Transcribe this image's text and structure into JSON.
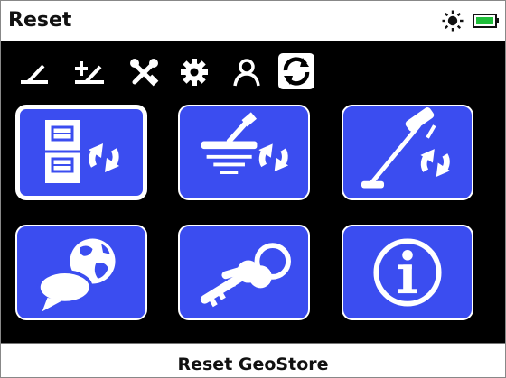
{
  "header": {
    "title": "Reset",
    "icons": [
      "sun-icon",
      "battery-icon"
    ],
    "battery_color": "#1fbe3a"
  },
  "tabs": [
    {
      "name": "detect-tab",
      "icon": "detect-icon",
      "selected": false
    },
    {
      "name": "ground-tab",
      "icon": "ground-balance-icon",
      "selected": false
    },
    {
      "name": "tools-tab",
      "icon": "tools-icon",
      "selected": false
    },
    {
      "name": "settings-tab",
      "icon": "gear-icon",
      "selected": false
    },
    {
      "name": "user-tab",
      "icon": "user-icon",
      "selected": false
    },
    {
      "name": "reset-tab",
      "icon": "reset-icon",
      "selected": true
    }
  ],
  "tiles": [
    {
      "name": "reset-geostore-tile",
      "icon": "geostore-reset-icon",
      "selected": true
    },
    {
      "name": "reset-coil-tile",
      "icon": "coil-reset-icon",
      "selected": false
    },
    {
      "name": "reset-detector-tile",
      "icon": "detector-reset-icon",
      "selected": false
    },
    {
      "name": "language-tile",
      "icon": "language-globe-icon",
      "selected": false
    },
    {
      "name": "keys-tile",
      "icon": "keys-icon",
      "selected": false
    },
    {
      "name": "info-tile",
      "icon": "info-icon",
      "selected": false
    }
  ],
  "footer": {
    "label": "Reset GeoStore"
  },
  "colors": {
    "tile_blue": "#3b4df0",
    "background": "#000000",
    "bar": "#ffffff"
  }
}
